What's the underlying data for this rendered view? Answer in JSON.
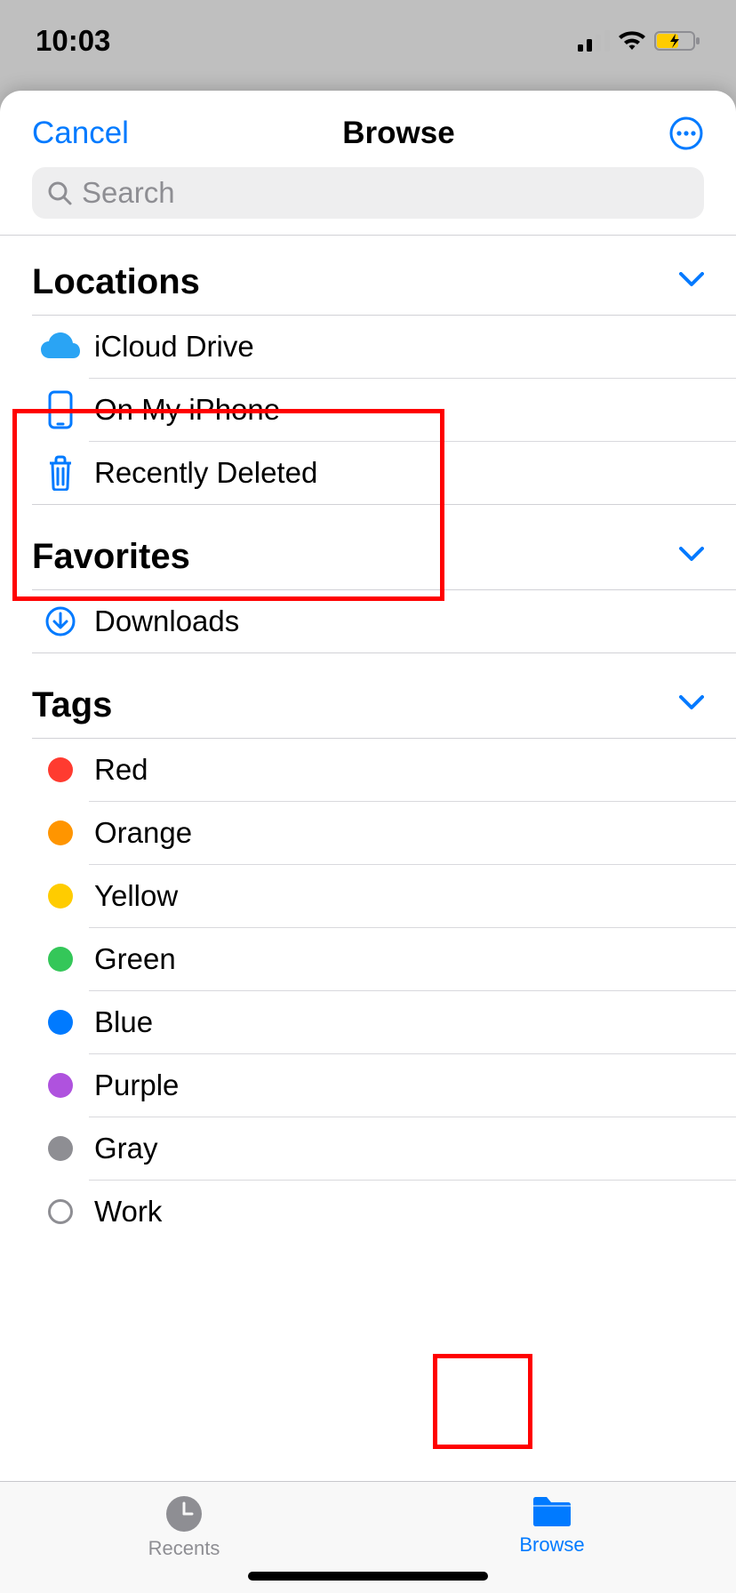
{
  "status": {
    "time": "10:03"
  },
  "nav": {
    "cancel": "Cancel",
    "title": "Browse"
  },
  "search": {
    "placeholder": "Search"
  },
  "sections": {
    "locations": {
      "title": "Locations",
      "items": {
        "icloud": "iCloud Drive",
        "onmy": "On My iPhone",
        "deleted": "Recently Deleted"
      }
    },
    "favorites": {
      "title": "Favorites",
      "items": {
        "downloads": "Downloads"
      }
    },
    "tags": {
      "title": "Tags",
      "items": {
        "red": {
          "label": "Red",
          "color": "#ff3b30"
        },
        "orange": {
          "label": "Orange",
          "color": "#ff9500"
        },
        "yellow": {
          "label": "Yellow",
          "color": "#ffcc00"
        },
        "green": {
          "label": "Green",
          "color": "#34c759"
        },
        "blue": {
          "label": "Blue",
          "color": "#007aff"
        },
        "purple": {
          "label": "Purple",
          "color": "#af52de"
        },
        "gray": {
          "label": "Gray",
          "color": "#8e8e93"
        },
        "work": {
          "label": "Work",
          "color": ""
        }
      }
    }
  },
  "tabbar": {
    "recents": "Recents",
    "browse": "Browse"
  }
}
